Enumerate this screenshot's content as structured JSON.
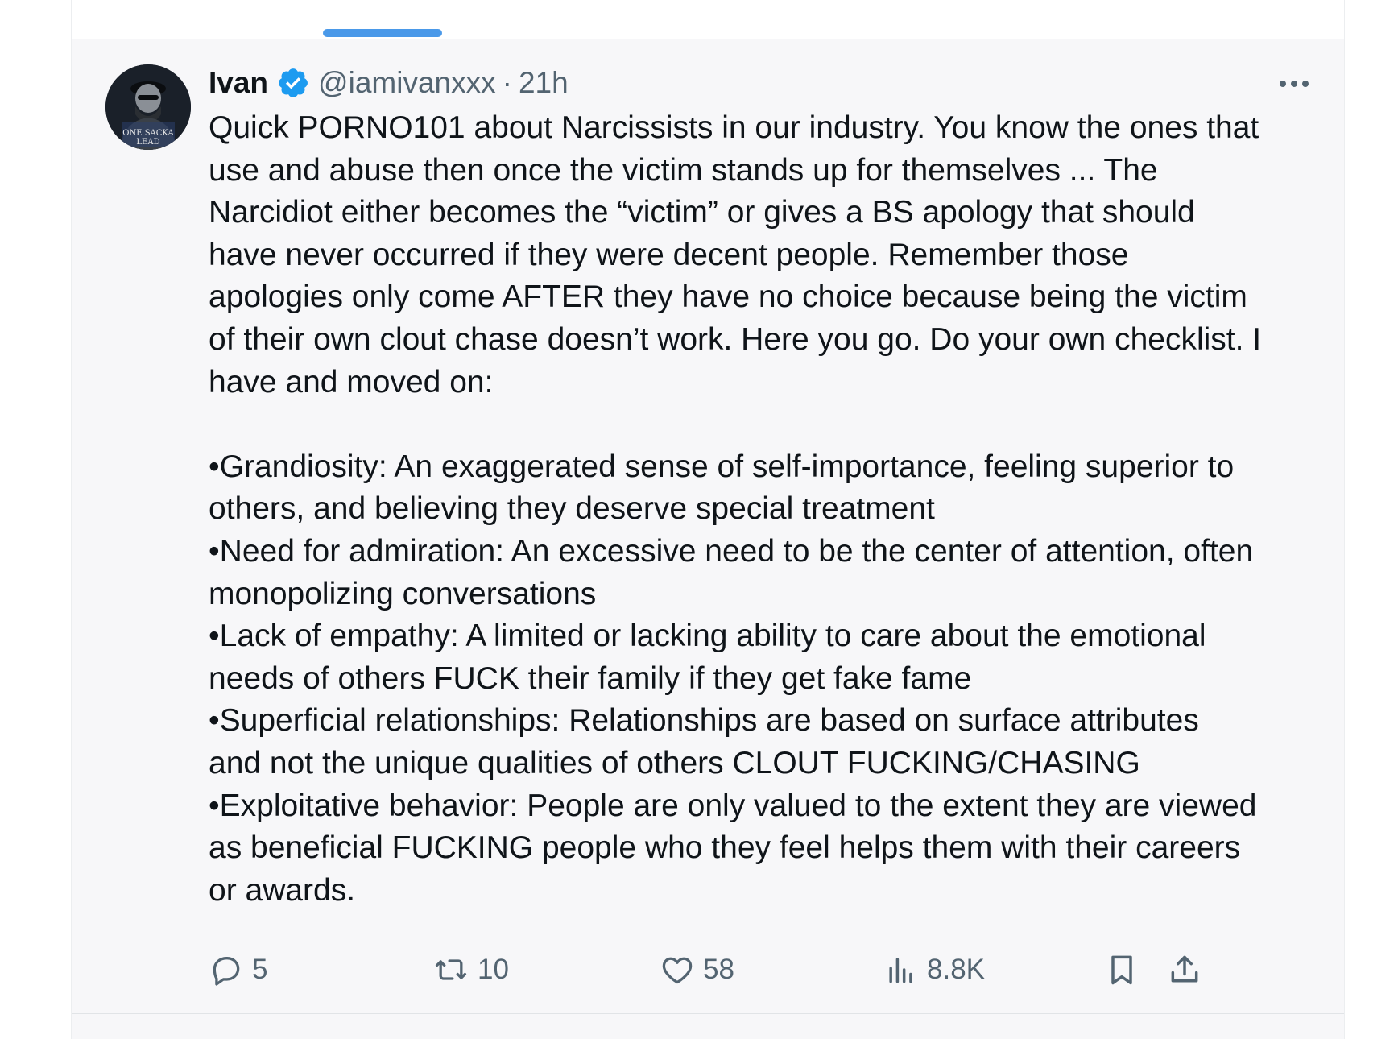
{
  "tweet": {
    "author_name": "Ivan",
    "handle": "@iamivanxxx",
    "separator": "·",
    "time": "21h",
    "text": "Quick PORNO101 about Narcissists in our industry. You know the ones that\nuse and abuse then once the victim stands up for themselves ... The\nNarcidiot either becomes the “victim” or gives a BS apology that should\nhave never occurred if they were decent people. Remember those\napologies only come AFTER they have no choice because being the victim\nof their own clout chase doesn’t work. Here you go. Do your own checklist. I\nhave and moved on:\n\n•Grandiosity: An exaggerated sense of self-importance, feeling superior to\nothers, and believing they deserve special treatment\n•Need for admiration: An excessive need to be the center of attention, often\nmonopolizing conversations\n•Lack of empathy: A limited or lacking ability to care about the emotional\nneeds of others FUCK their family if they get fake fame\n•Superficial relationships: Relationships are based on surface attributes\nand not the unique qualities of others CLOUT FUCKING/CHASING\n•Exploitative behavior: People are only valued to the extent they are viewed\nas beneficial FUCKING people who they feel helps them with their careers\nor awards.",
    "avatar_icon": "avatar-photo",
    "verified_icon": "verified-badge-icon",
    "more_icon": "more-dots-icon"
  },
  "actions": {
    "reply_count": "5",
    "retweet_count": "10",
    "like_count": "58",
    "views_count": "8.8K"
  },
  "colors": {
    "accent": "#1d9bf0",
    "tab_indicator": "#4a99e9",
    "text_primary": "#0f1419",
    "text_secondary": "#536471",
    "column_bg": "#f7f7f9"
  }
}
